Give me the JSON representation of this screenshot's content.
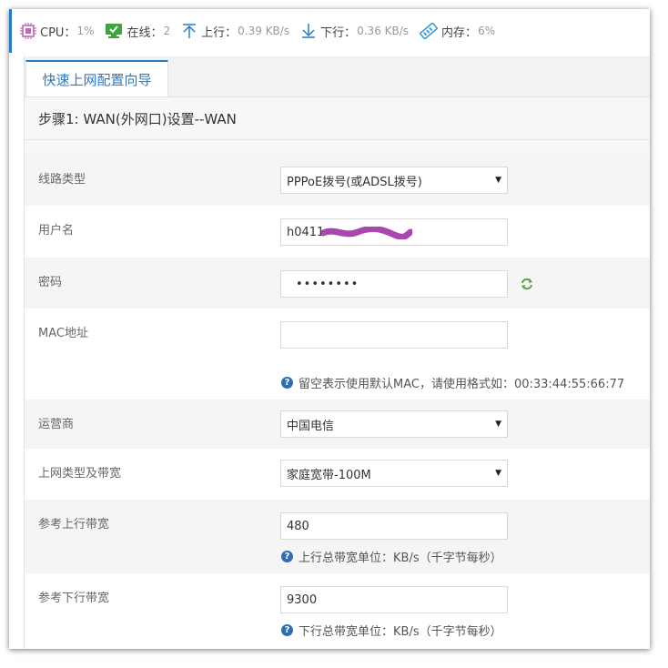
{
  "status": {
    "cpu_label": "CPU：",
    "cpu_value": "1%",
    "online_label": "在线：",
    "online_value": "2",
    "up_label": "上行：",
    "up_value": "0.39 KB/s",
    "down_label": "下行：",
    "down_value": "0.36 KB/s",
    "mem_label": "内存：",
    "mem_value": "6%"
  },
  "tabs": {
    "wizard": "快速上网配置向导"
  },
  "step": {
    "title": "步骤1: WAN(外网口)设置--WAN"
  },
  "form": {
    "line_type": {
      "label": "线路类型",
      "value": "PPPoE拨号(或ADSL拨号)"
    },
    "username": {
      "label": "用户名",
      "value": "h0411"
    },
    "password": {
      "label": "密码",
      "value": "••••••••"
    },
    "mac": {
      "label": "MAC地址",
      "value": "",
      "hint": "留空表示使用默认MAC，请使用格式如：00:33:44:55:66:77"
    },
    "isp": {
      "label": "运营商",
      "value": "中国电信"
    },
    "access": {
      "label": "上网类型及带宽",
      "value": "家庭宽带-100M"
    },
    "up_bw": {
      "label": "参考上行带宽",
      "value": "480",
      "hint": "上行总带宽单位：KB/s（千字节每秒）"
    },
    "down_bw": {
      "label": "参考下行带宽",
      "value": "9300",
      "hint": "下行总带宽单位：KB/s（千字节每秒）"
    }
  },
  "colors": {
    "accent": "#2b7ac8",
    "cpu_icon": "#c06ab5",
    "online_icon": "#3aa53a",
    "mem_icon": "#3d9bd4",
    "redact": "#a946b0",
    "refresh": "#5fa33a"
  }
}
